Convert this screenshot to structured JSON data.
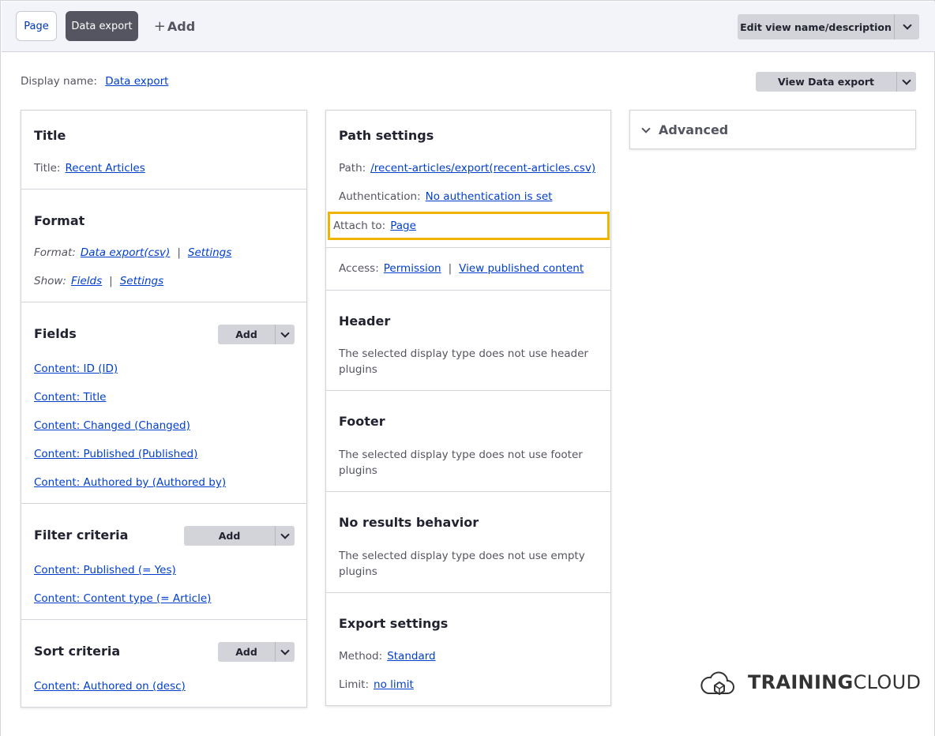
{
  "tabs": {
    "page": "Page",
    "data_export": "Data export",
    "add": "Add"
  },
  "header": {
    "edit_button": "Edit view name/description",
    "view_button": "View Data export",
    "display_name_label": "Display name:",
    "display_name_value": "Data export"
  },
  "title_section": {
    "heading": "Title",
    "label": "Title:",
    "value": "Recent Articles"
  },
  "format_section": {
    "heading": "Format",
    "format_label": "Format:",
    "format_value": "Data export(csv)",
    "format_settings": "Settings",
    "show_label": "Show:",
    "show_value": "Fields",
    "show_settings": "Settings",
    "separator": "|"
  },
  "fields_section": {
    "heading": "Fields",
    "add_label": "Add",
    "items": [
      "Content: ID (ID)",
      "Content: Title",
      "Content: Changed (Changed)",
      "Content: Published (Published)",
      "Content: Authored by (Authored by)"
    ]
  },
  "filter_section": {
    "heading": "Filter criteria",
    "add_label": "Add",
    "items": [
      "Content: Published (= Yes)",
      "Content: Content type (= Article)"
    ]
  },
  "sort_section": {
    "heading": "Sort criteria",
    "add_label": "Add",
    "items": [
      "Content: Authored on (desc)"
    ]
  },
  "path_section": {
    "heading": "Path settings",
    "path_label": "Path:",
    "path_value": "/recent-articles/export(recent-articles.csv)",
    "auth_label": "Authentication:",
    "auth_value": "No authentication is set",
    "attach_label": "Attach to:",
    "attach_value": "Page",
    "access_label": "Access:",
    "access_value": "Permission",
    "access_separator": "|",
    "access_value2": "View published content"
  },
  "header_section": {
    "heading": "Header",
    "text": "The selected display type does not use header plugins"
  },
  "footer_section": {
    "heading": "Footer",
    "text": "The selected display type does not use footer plugins"
  },
  "noresults_section": {
    "heading": "No results behavior",
    "text": "The selected display type does not use empty plugins"
  },
  "export_section": {
    "heading": "Export settings",
    "method_label": "Method:",
    "method_value": "Standard",
    "limit_label": "Limit:",
    "limit_value": "no limit"
  },
  "advanced": {
    "heading": "Advanced"
  },
  "logo": {
    "bold": "TRAINING",
    "rest": "CLOUD"
  },
  "colors": {
    "link": "#003ecc",
    "highlight": "#f0b400",
    "active_tab": "#545560"
  }
}
